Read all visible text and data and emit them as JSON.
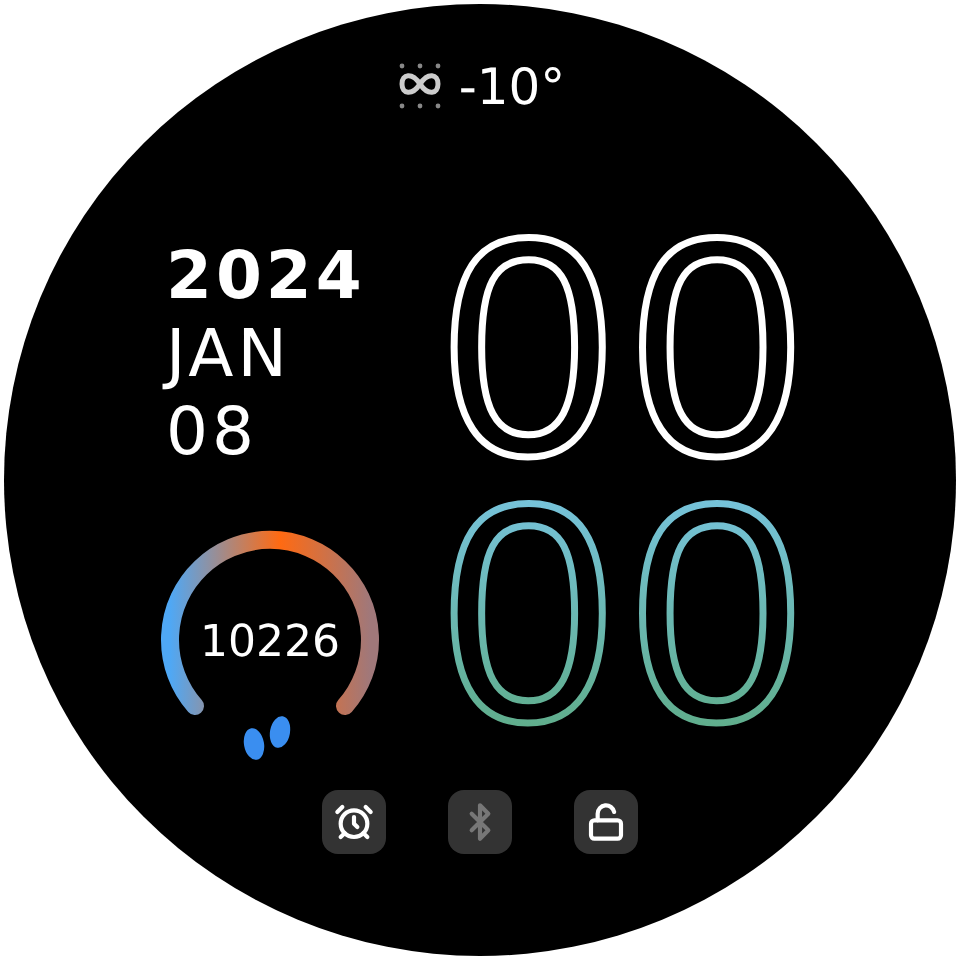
{
  "weather": {
    "temperature": "-10°"
  },
  "date": {
    "year": "2024",
    "month": "JAN",
    "day": "08"
  },
  "time": {
    "hours": "00",
    "minutes": "00"
  },
  "steps": {
    "count": "10226"
  },
  "status_icons": [
    {
      "kind": "alarm",
      "on": true
    },
    {
      "kind": "bluetooth",
      "on": false
    },
    {
      "kind": "lock",
      "on": true
    }
  ]
}
